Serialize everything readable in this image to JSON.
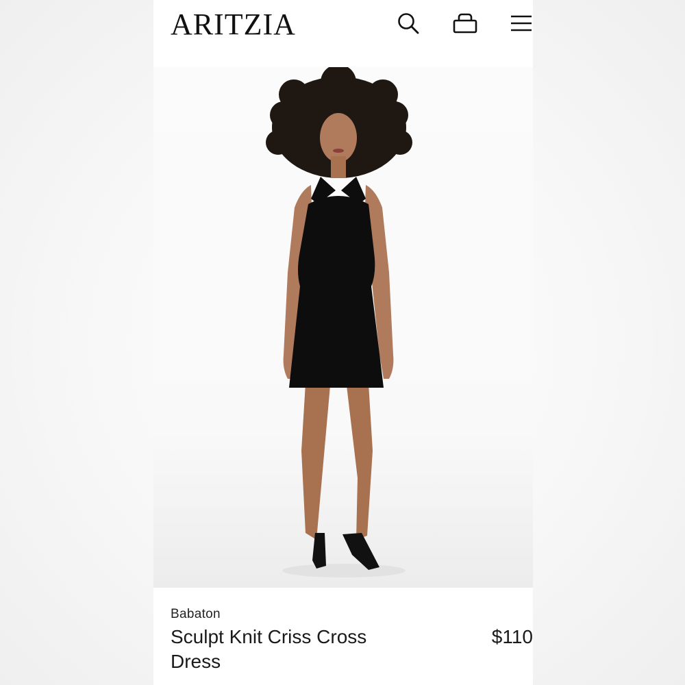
{
  "header": {
    "logo": "ARITZIA",
    "icons": [
      "search-icon",
      "shopping-bag-icon",
      "hamburger-menu-icon"
    ]
  },
  "product": {
    "brand": "Babaton",
    "name": "Sculpt Knit Criss Cross Dress",
    "price": "$110",
    "image": "model-in-black-halter-dress"
  },
  "colors": {
    "text": "#1a1a1a",
    "dress": "#0d0d0d",
    "skin": "#b07a5c",
    "hair": "#1f1712"
  }
}
